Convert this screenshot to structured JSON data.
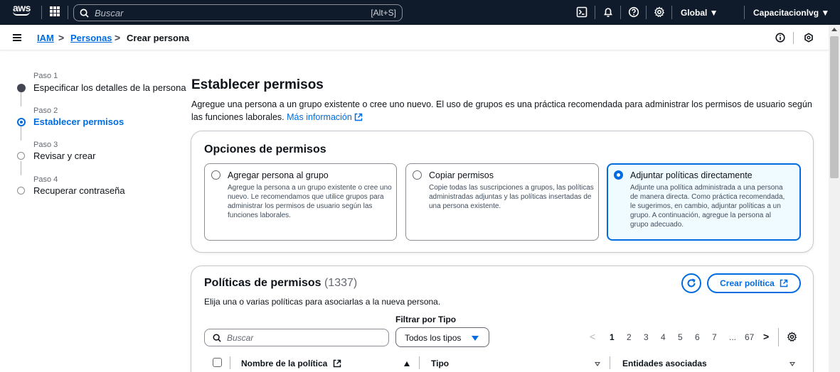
{
  "topnav": {
    "logo": "aws",
    "search_placeholder": "Buscar",
    "search_shortcut": "[Alt+S]",
    "region": "Global ▼",
    "account": "Capacitacionlvg ▼",
    "icons": [
      "grid-icon",
      "search-icon",
      "cloudshell-icon",
      "bell-icon",
      "help-icon",
      "gear-icon"
    ]
  },
  "breadcrumb": {
    "items": [
      "IAM",
      "Personas",
      "Crear persona"
    ],
    "separator": ">"
  },
  "stepper": {
    "steps": [
      {
        "label": "Paso 1",
        "title": "Especificar los detalles de la persona",
        "state": "done"
      },
      {
        "label": "Paso 2",
        "title": "Establecer permisos",
        "state": "active"
      },
      {
        "label": "Paso 3",
        "title": "Revisar y crear",
        "state": "todo"
      },
      {
        "label": "Paso 4",
        "title": "Recuperar contraseña",
        "state": "todo"
      }
    ]
  },
  "main": {
    "title": "Establecer permisos",
    "description": "Agregue una persona a un grupo existente o cree uno nuevo. El uso de grupos es una práctica recomendada para administrar los permisos de usuario según las funciones laborales.",
    "more_info": "Más información"
  },
  "permission_options": {
    "title": "Opciones de permisos",
    "options": [
      {
        "title": "Agregar persona al grupo",
        "description": "Agregue la persona a un grupo existente o cree uno nuevo. Le recomendamos que utilice grupos para administrar los permisos de usuario según las funciones laborales.",
        "selected": false
      },
      {
        "title": "Copiar permisos",
        "description": "Copie todas las suscripciones a grupos, las políticas administradas adjuntas y las políticas insertadas de una persona existente.",
        "selected": false
      },
      {
        "title": "Adjuntar políticas directamente",
        "description": "Adjunte una política administrada a una persona de manera directa. Como práctica recomendada, le sugerimos, en cambio, adjuntar políticas a un grupo. A continuación, agregue la persona al grupo adecuado.",
        "selected": true
      }
    ]
  },
  "policies": {
    "title": "Políticas de permisos",
    "count": "(1337)",
    "subtitle": "Elija una o varias políticas para asociarlas a la nueva persona.",
    "create_button": "Crear política",
    "search_placeholder": "Buscar",
    "filter_label": "Filtrar por Tipo",
    "filter_value": "Todos los tipos",
    "pagination": {
      "prev": "<",
      "pages": [
        "1",
        "2",
        "3",
        "4",
        "5",
        "6",
        "7",
        "...",
        "67"
      ],
      "next": ">",
      "current": "1"
    },
    "columns": [
      "Nombre de la política",
      "Tipo",
      "Entidades asociadas"
    ]
  },
  "colors": {
    "nav_bg": "#0f1b2a",
    "accent": "#006ce0",
    "selected_tile_bg": "#f0fbff"
  }
}
